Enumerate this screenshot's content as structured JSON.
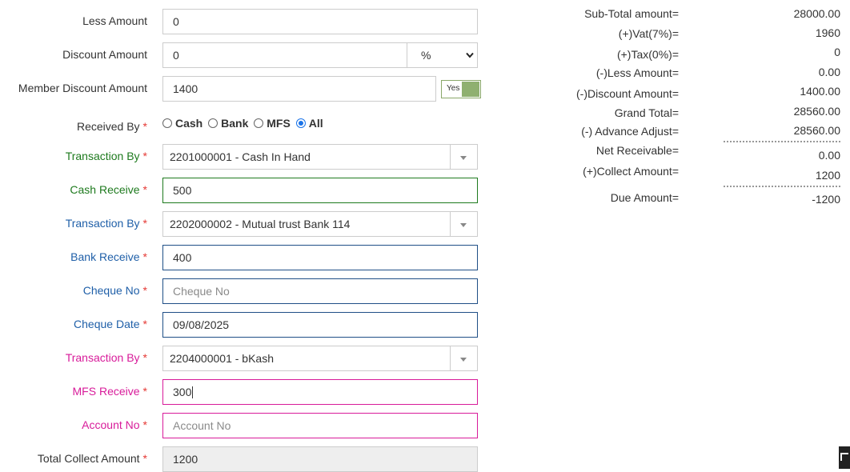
{
  "form": {
    "less_amount": {
      "label": "Less Amount",
      "value": "0"
    },
    "discount_amount": {
      "label": "Discount Amount",
      "value": "0",
      "type_option": "%"
    },
    "member_discount": {
      "label": "Member Discount Amount",
      "value": "1400",
      "toggle_label": "Yes"
    },
    "received_by": {
      "label": "Received By",
      "required_mark": "*",
      "options": [
        "Cash",
        "Bank",
        "MFS",
        "All"
      ],
      "selected": "All"
    },
    "cash": {
      "transaction_label": "Transaction By",
      "transaction_value": "2201000001 - Cash In Hand",
      "receive_label": "Cash Receive",
      "receive_value": "500"
    },
    "bank": {
      "transaction_label": "Transaction By",
      "transaction_value": "2202000002 - Mutual trust Bank 114",
      "receive_label": "Bank Receive",
      "receive_value": "400",
      "cheque_no_label": "Cheque No",
      "cheque_no_placeholder": "Cheque No",
      "cheque_date_label": "Cheque Date",
      "cheque_date_value": "09/08/2025"
    },
    "mfs": {
      "transaction_label": "Transaction By",
      "transaction_value": "2204000001 - bKash",
      "receive_label": "MFS Receive",
      "receive_value": "300",
      "account_no_label": "Account No",
      "account_no_placeholder": "Account No"
    },
    "total_collect": {
      "label": "Total Collect Amount",
      "value": "1200"
    }
  },
  "summary": [
    {
      "label": "Sub-Total amount=",
      "value": "28000.00"
    },
    {
      "label": "(+)Vat(7%)=",
      "value": "1960"
    },
    {
      "label": "(+)Tax(0%)=",
      "value": "0"
    },
    {
      "label": "(-)Less Amount=",
      "value": "0.00"
    },
    {
      "label": "(-)Discount Amount=",
      "value": "1400.00"
    },
    {
      "label": "Grand Total=",
      "value": "28560.00"
    },
    {
      "label": "(-) Advance Adjust=",
      "value": "28560.00"
    },
    {
      "label": "Net Receivable=",
      "value": "0.00"
    },
    {
      "label": "(+)Collect Amount=",
      "value": "1200"
    },
    {
      "label": "Due Amount=",
      "value": "-1200"
    }
  ],
  "colors": {
    "cash_section": "#1e7a1e",
    "bank_section": "#1f5fa8",
    "mfs_section": "#d81b9a",
    "required": "#e53935",
    "toggle_on": "#8fb070"
  },
  "icons": {
    "select_arrow": "triangle-down",
    "corner": "arrow-up-left-icon"
  }
}
